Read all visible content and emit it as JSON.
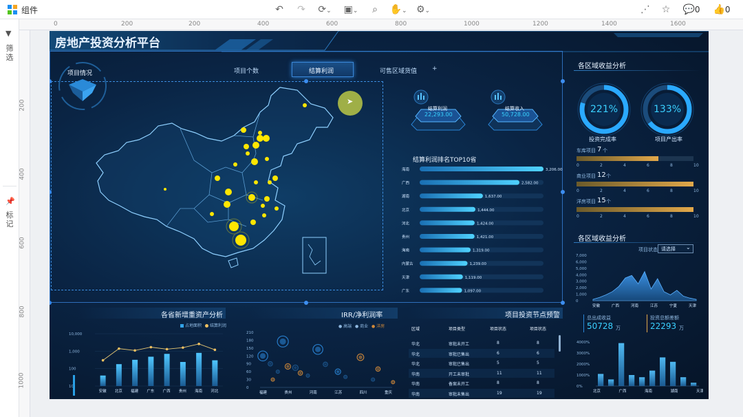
{
  "app": {
    "title": "组件"
  },
  "toolbar": {
    "comment_count": "0",
    "like_count": "0"
  },
  "rail": {
    "filter_label": "筛选",
    "mark_label": "标记"
  },
  "ruler": {
    "top": [
      "0",
      "200",
      "400",
      "600",
      "800",
      "1000",
      "1200",
      "1400",
      "1600",
      "1800"
    ],
    "left": [
      "200",
      "400",
      "600",
      "800",
      "1000"
    ]
  },
  "dashboard": {
    "title": "房地产投资分析平台",
    "map_label": "项目情况",
    "tabs": [
      "项目个数",
      "结算利润",
      "可售区域货值"
    ],
    "tab_plus": "+",
    "kpi_profit_label": "结算利润",
    "kpi_profit_value": "22,293.00",
    "kpi_income_label": "结算收入",
    "kpi_income_value": "50,728.00",
    "region_title": "各区域收益分析",
    "gauge1_value": "221%",
    "gauge1_label": "投资完成率",
    "gauge2_value": "133%",
    "gauge2_label": "项目产出率",
    "progress": [
      {
        "label": "车库项目",
        "num": "7",
        "unit": "个",
        "value": 7
      },
      {
        "label": "商业项目",
        "num": "12",
        "unit": "个",
        "value": 12
      },
      {
        "label": "洋房项目",
        "num": "15",
        "unit": "个",
        "value": 15
      }
    ],
    "progress_ticks": [
      "0",
      "2",
      "4",
      "6",
      "8",
      "10"
    ],
    "region_title2": "各区域收益分析",
    "status_label": "项目状态",
    "status_select": "请选择",
    "yield_label": "总出成收益",
    "yield_value": "50728",
    "yield_unit": "万",
    "invest_label": "投资总额差额",
    "invest_value": "22293",
    "invest_unit": "万",
    "province_chart_title": "各省新增重资产分析",
    "legend_area": "占地面积",
    "legend_profit": "结算利润",
    "irr_title": "IRR/净利润率",
    "irr_legends": [
      "高端",
      "商业",
      "洋房"
    ],
    "node_title": "项目投资节点预警",
    "table_headers": [
      "区域",
      "项目类型",
      "项目状态",
      "项目状态"
    ],
    "table_rows": [
      [
        "华北",
        "审批未开工",
        "8",
        "8"
      ],
      [
        "华北",
        "审批已售出",
        "6",
        "6"
      ],
      [
        "华北",
        "审批已售出",
        "5",
        "5"
      ],
      [
        "华南",
        "开工未审批",
        "11",
        "11"
      ],
      [
        "华南",
        "备案未开工",
        "8",
        "8"
      ],
      [
        "华南",
        "审批未售出",
        "19",
        "19"
      ]
    ]
  },
  "chart_data": [
    {
      "type": "bar",
      "title": "结算利润排名TOP10省",
      "categories": [
        "海南",
        "广西",
        "湖南",
        "北京",
        "河北",
        "贵州",
        "海南",
        "内蒙古",
        "天津",
        "广东"
      ],
      "values": [
        3206,
        2582,
        1637,
        1444,
        1424,
        1421,
        1319,
        1239,
        1119,
        1097
      ],
      "labels": [
        "3,206.00",
        "2,582.00",
        "1,637.00",
        "1,444.00",
        "1,424.00",
        "1,421.00",
        "1,319.00",
        "1,239.00",
        "1,119.00",
        "1,097.00"
      ],
      "orientation": "horizontal"
    },
    {
      "type": "area",
      "categories": [
        "安徽",
        "广西",
        "河南",
        "江苏",
        "宁夏",
        "天津"
      ],
      "ylim": [
        0,
        7000
      ],
      "yticks": [
        "0",
        "1,000",
        "2,000",
        "3,000",
        "4,000",
        "5,000",
        "6,000",
        "7,000"
      ],
      "values": [
        200,
        500,
        900,
        1400,
        2200,
        3500,
        3900,
        2600,
        4500,
        1800,
        3400,
        1400,
        900,
        1600,
        700,
        400,
        200
      ]
    },
    {
      "type": "bar",
      "categories": [
        "北京",
        "广西",
        "海南",
        "湖南",
        "天津"
      ],
      "yticks": [
        "0%",
        "1000%",
        "2000%",
        "3000%",
        "4000%"
      ],
      "ylim": [
        0,
        4000
      ],
      "values": [
        1100,
        600,
        3900,
        1000,
        800,
        1400,
        2600,
        2200,
        800,
        300
      ]
    },
    {
      "type": "bar",
      "title": "各省新增重资产分析",
      "categories": [
        "安徽",
        "北京",
        "福建",
        "广东",
        "广西",
        "贵州",
        "海南",
        "河北"
      ],
      "y_scale": "log",
      "yticks": [
        "10",
        "100",
        "1,000",
        "10,000"
      ],
      "ylim": [
        10,
        10000
      ],
      "series": [
        {
          "name": "占地面积",
          "values": [
            40,
            180,
            320,
            480,
            700,
            240,
            800,
            300
          ]
        },
        {
          "name": "结算利润",
          "values": [
            300,
            1400,
            1100,
            1700,
            1300,
            1600,
            2600,
            1200
          ]
        }
      ]
    },
    {
      "type": "scatter",
      "title": "IRR/净利润率",
      "categories": [
        "福建",
        "贵州",
        "河南",
        "江苏",
        "四川",
        "重庆"
      ],
      "yticks": [
        "0",
        "30",
        "60",
        "90",
        "120",
        "150",
        "180",
        "210"
      ],
      "ylim": [
        0,
        210
      ],
      "series": [
        {
          "name": "高端",
          "points": [
            [
              0,
              120,
              9
            ],
            [
              0.8,
              175,
              10
            ],
            [
              2.2,
              145,
              9
            ],
            [
              3.0,
              60,
              5
            ]
          ]
        },
        {
          "name": "商业",
          "points": [
            [
              0.3,
              90,
              4
            ],
            [
              0.6,
              60,
              3
            ],
            [
              1.3,
              75,
              5
            ],
            [
              1.8,
              45,
              3
            ],
            [
              2.5,
              88,
              4
            ],
            [
              3.3,
              40,
              3
            ],
            [
              4.4,
              30,
              3
            ]
          ]
        },
        {
          "name": "洋房",
          "points": [
            [
              0.4,
              30,
              3
            ],
            [
              1.0,
              80,
              5
            ],
            [
              1.5,
              55,
              4
            ],
            [
              3.9,
              115,
              6
            ],
            [
              4.6,
              70,
              4
            ],
            [
              5.2,
              20,
              3
            ]
          ]
        }
      ]
    }
  ]
}
